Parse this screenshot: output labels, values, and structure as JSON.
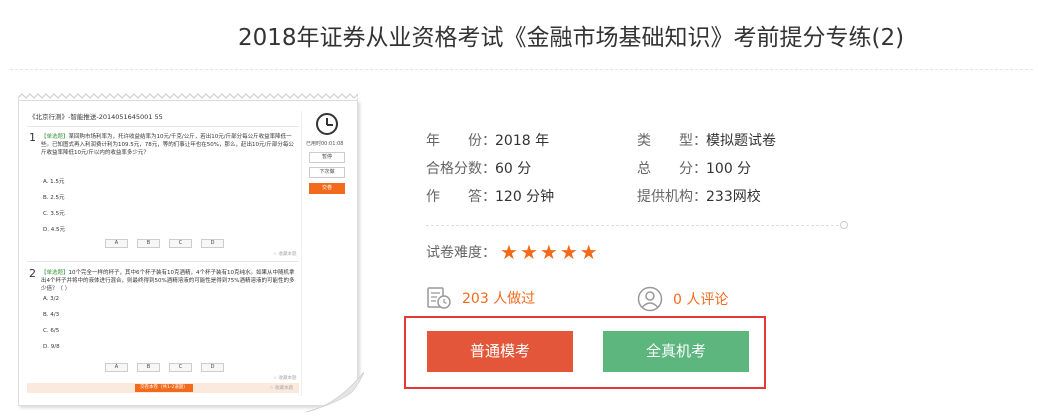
{
  "page": {
    "title": "2018年证券从业资格考试《金融市场基础知识》考前提分专练(2)"
  },
  "preview": {
    "header": "《北京行测》-智能推送-2014051645001 55",
    "timer": "已用时00:01:08",
    "side_buttons": [
      "暂停",
      "下次做",
      "交卷"
    ],
    "questions": [
      {
        "number": "1",
        "type": "【单选题】",
        "text": "某回购市场利率为，托许收益结率为10元/千克/公斤，若出10元/斤部分每公斤收益率降低一些。已知图式再入利润费计利为109.5元，78元，等的们事让年也在50%，那么，赶出10元/斤部分每公斤收益率降低10元/斤以内的收益率多少元？",
        "options": [
          "A. 1.5元",
          "B. 2.5元",
          "C. 3.5元",
          "D. 4.5元"
        ],
        "choices": [
          "A",
          "B",
          "C",
          "D"
        ],
        "collect": "☆ 收藏本题"
      },
      {
        "number": "2",
        "type": "【单选题】",
        "text": "10个完全一样的杯子，其中6个杯子装有10克酒精，4个杯子装有10克纯水。如果从中随机拿出4个杯子并将中的液体进行混合，则最终得到50%酒精溶液的可能性是得到75%酒精溶液的可能性的多少倍？（ ）",
        "options": [
          "A. 3/2",
          "B. 4/3",
          "C. 6/5",
          "D. 9/8"
        ],
        "choices": [
          "A",
          "B",
          "C",
          "D"
        ],
        "collect": "☆ 收藏本题"
      }
    ],
    "bottom_button": "交卷本卷（共1-2道题）",
    "bottom_collect": "☆ 收藏本题"
  },
  "info": {
    "year_label": "年　　份：",
    "year_value": "2018 年",
    "type_label": "类　　型：",
    "type_value": "模拟题试卷",
    "pass_label": "合格分数：",
    "pass_value": "60 分",
    "total_label": "总　　分：",
    "total_value": "100 分",
    "time_label": "作　　答：",
    "time_value": "120 分钟",
    "org_label": "提供机构：",
    "org_value": "233网校"
  },
  "difficulty": {
    "label": "试卷难度：",
    "stars": 5,
    "star_glyph": "★"
  },
  "stats": {
    "done_text": "203 人做过",
    "comment_text": "0 人评论"
  },
  "buttons": {
    "normal_label": "普通模考",
    "real_label": "全真机考"
  },
  "colors": {
    "accent_orange": "#f26b1d",
    "normal_button": "#e4563a",
    "real_button": "#5cb67e",
    "highlight_border": "#e53935"
  }
}
